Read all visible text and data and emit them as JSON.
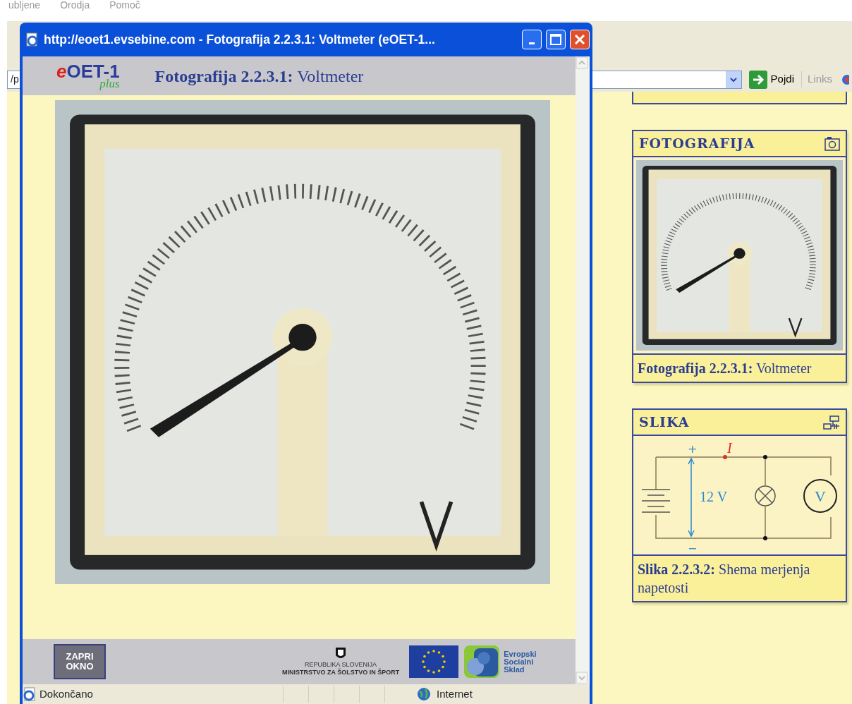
{
  "background_browser": {
    "menu": [
      "ubljene",
      "Orodja",
      "Pomoč"
    ],
    "address_fragment": "/p",
    "go_button": "Pojdi",
    "links": "Links",
    "cards": [
      {
        "title": "FOTOGRAFIJA",
        "caption": "**Fotografija 2.2.3.1:** Voltmeter"
      },
      {
        "kind": "diagram",
        "title": "SLIKA",
        "caption": "**Slika 2.2.3.2:** Shema merjenja napetosti",
        "diagram_labels": {
          "plus": "+",
          "current": "I",
          "voltage": "12 V",
          "minus": "−",
          "meter": "V"
        }
      }
    ]
  },
  "popup": {
    "title": "http://eoet1.evsebine.com - Fotografija 2.2.3.1: Voltmeter (eOET-1...",
    "logo": {
      "prefix": "e",
      "main": "OET-1",
      "sub": "plus"
    },
    "heading": "**Fotografija 2.2.3.1:** Voltmeter",
    "close_button": "ZAPRI OKNO",
    "ministry": [
      "REPUBLIKA SLOVENIJA",
      "MINISTRSTVO ZA ŠOLSTVO IN ŠPORT"
    ],
    "ess": [
      "Evropski",
      "Socialni",
      "Sklad"
    ],
    "status": "Dokončano",
    "zone": "Internet"
  }
}
